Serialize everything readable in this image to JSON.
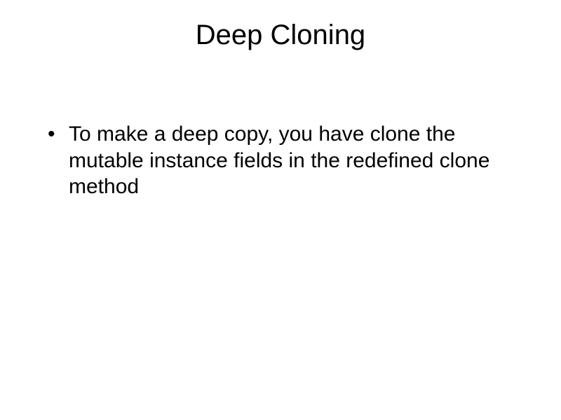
{
  "slide": {
    "title": "Deep Cloning",
    "bullets": [
      "To make a deep copy, you have clone the mutable instance fields in the redefined clone method"
    ]
  }
}
